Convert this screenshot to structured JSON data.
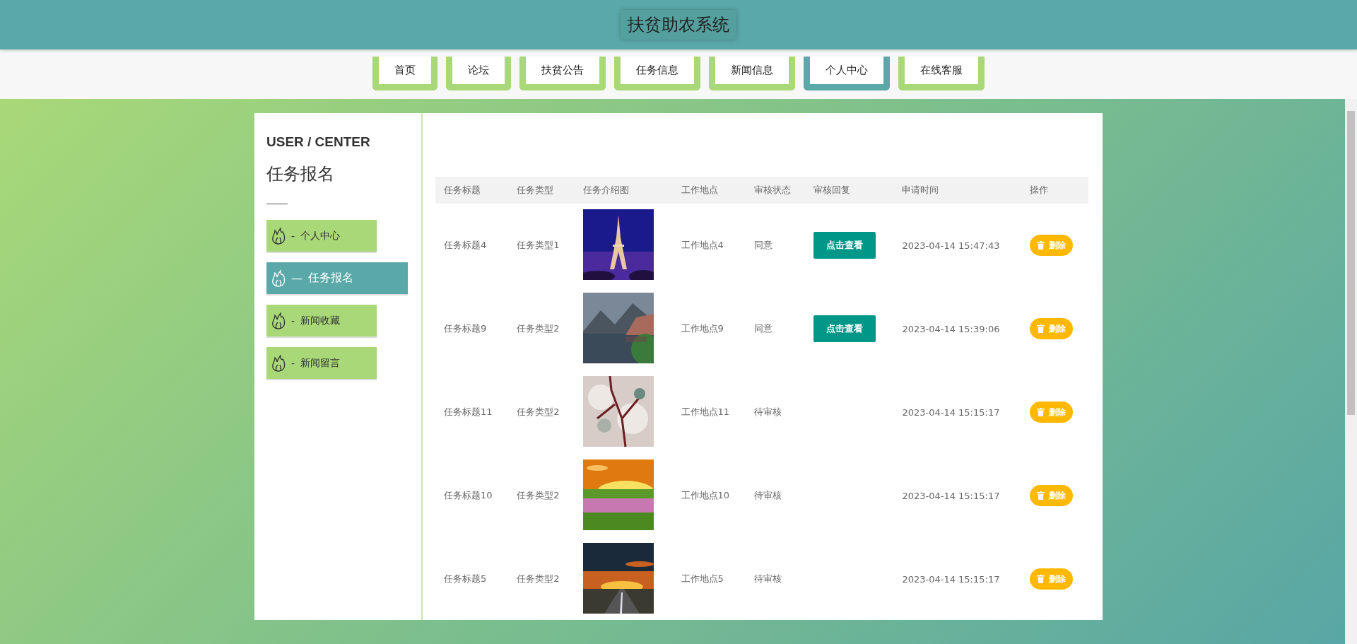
{
  "header": {
    "title": "扶贫助农系统"
  },
  "nav": [
    {
      "label": "首页",
      "selected": false
    },
    {
      "label": "论坛",
      "selected": false
    },
    {
      "label": "扶贫公告",
      "selected": false
    },
    {
      "label": "任务信息",
      "selected": false
    },
    {
      "label": "新闻信息",
      "selected": false
    },
    {
      "label": "个人中心",
      "selected": true
    },
    {
      "label": "在线客服",
      "selected": false
    }
  ],
  "sidebar": {
    "caption": "USER / CENTER",
    "heading": "任务报名",
    "items": [
      {
        "prefix": "-",
        "label": "个人中心",
        "selected": false
      },
      {
        "prefix": "—",
        "label": "任务报名",
        "selected": true
      },
      {
        "prefix": "-",
        "label": "新闻收藏",
        "selected": false
      },
      {
        "prefix": "-",
        "label": "新闻留言",
        "selected": false
      }
    ]
  },
  "table": {
    "columns": [
      "任务标题",
      "任务类型",
      "任务介绍图",
      "工作地点",
      "审核状态",
      "审核回复",
      "申请时间",
      "操作"
    ],
    "rows": [
      {
        "title": "任务标题4",
        "type": "任务类型1",
        "location": "工作地点4",
        "status": "同意",
        "reply": "点击查看",
        "time": "2023-04-14 15:47:43",
        "action": "删除"
      },
      {
        "title": "任务标题9",
        "type": "任务类型2",
        "location": "工作地点9",
        "status": "同意",
        "reply": "点击查看",
        "time": "2023-04-14 15:39:06",
        "action": "删除"
      },
      {
        "title": "任务标题11",
        "type": "任务类型2",
        "location": "工作地点11",
        "status": "待审核",
        "time": "2023-04-14 15:15:17",
        "action": "删除"
      },
      {
        "title": "任务标题10",
        "type": "任务类型2",
        "location": "工作地点10",
        "status": "待审核",
        "time": "2023-04-14 15:15:17",
        "action": "删除"
      },
      {
        "title": "任务标题5",
        "type": "任务类型2",
        "location": "工作地点5",
        "status": "待审核",
        "time": "2023-04-14 15:15:17",
        "action": "删除"
      }
    ]
  }
}
